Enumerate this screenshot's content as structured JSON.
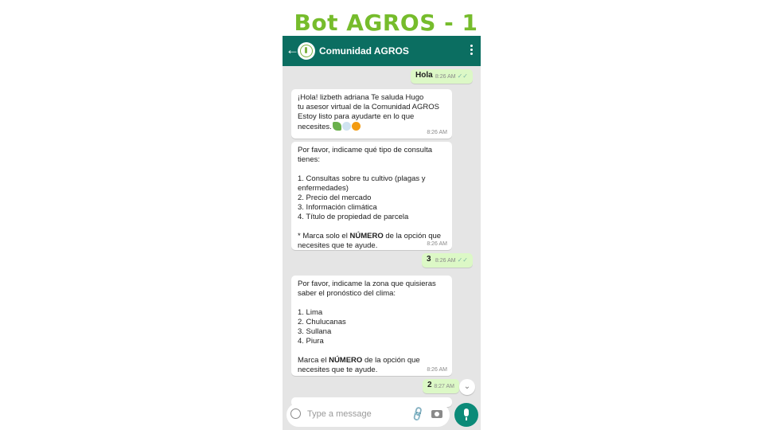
{
  "slide_title": "Bot AGROS - 1",
  "header": {
    "chat_name": "Comunidad AGROS"
  },
  "messages": [
    {
      "dir": "out",
      "text": "Hola",
      "time": "8:26 AM"
    },
    {
      "dir": "in",
      "lines": [
        "¡Hola! lizbeth adriana Te saluda Hugo",
        "tu asesor virtual de la Comunidad AGROS",
        "Estoy listo para ayudarte en lo que",
        "necesites."
      ],
      "time": "8:26 AM"
    },
    {
      "dir": "in",
      "lines": [
        "Por favor, indicame qué tipo de consulta",
        "tienes:",
        "",
        "1. Consultas sobre tu cultivo (plagas y",
        "enfermedades)",
        "2. Precio del mercado",
        "3. Información climática",
        "4. Título de propiedad de parcela",
        ""
      ],
      "note_pre": "* Marca solo el ",
      "note_bold": "NÚMERO",
      "note_post": " de la opción que",
      "note_last": "necesites que te ayude.",
      "time": "8:26 AM"
    },
    {
      "dir": "out",
      "text": "3",
      "time": "8:26 AM"
    },
    {
      "dir": "in",
      "lines": [
        "Por favor, indicame la zona que quisieras",
        "saber el pronóstico del clima:",
        "",
        "1. Lima",
        "2. Chulucanas",
        "3. Sullana",
        "4. Piura",
        ""
      ],
      "note_pre": "Marca el ",
      "note_bold": "NÚMERO",
      "note_post": " de la opción que",
      "note_last": "necesites que te ayude.",
      "time": "8:26 AM"
    },
    {
      "dir": "out",
      "text": "2",
      "time": "8:27 AM"
    }
  ],
  "input": {
    "placeholder": "Type a message"
  },
  "colors": {
    "title_green": "#76bc2c",
    "appbar": "#0b6e61",
    "outgoing_bubble": "#dcf8c6",
    "chat_bg": "#e5e5e5",
    "mic_button": "#0b8a78"
  },
  "icons": [
    "back-arrow-icon",
    "avatar-logo-icon",
    "more-vert-icon",
    "double-check-icon",
    "scroll-down-icon",
    "emoji-icon",
    "attach-icon",
    "camera-icon",
    "mic-icon"
  ]
}
